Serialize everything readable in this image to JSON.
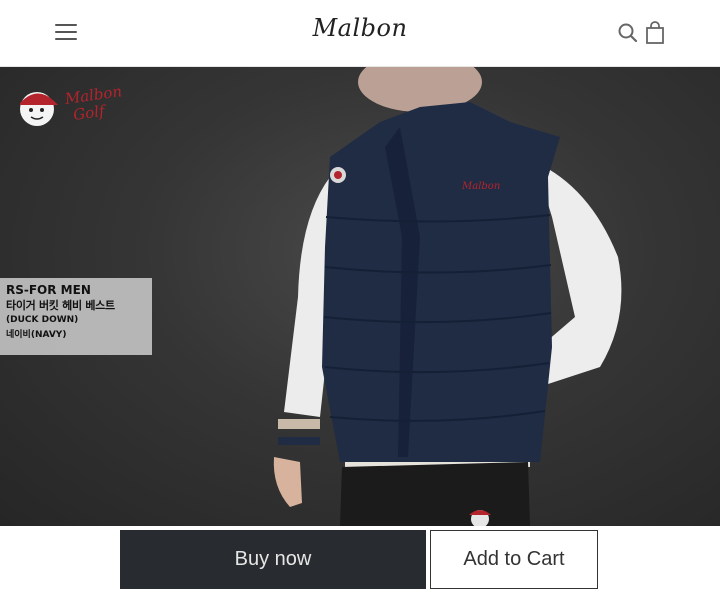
{
  "header": {
    "logo": "Malbon",
    "menu_icon": "hamburger-menu-icon",
    "search_icon": "search-icon",
    "bag_icon": "shopping-bag-icon"
  },
  "hero": {
    "brand_badge": {
      "line1": "Malbon",
      "line2": "Golf",
      "color": "#b3242c",
      "icon": "golf-ball-mascot-icon"
    },
    "vest_logo": "Malbon",
    "product": {
      "line1": "RS-FOR MEN",
      "line2": "타이거 버킷 헤비 베스트",
      "line3": "(DUCK DOWN)",
      "line4": "네이비(NAVY)"
    }
  },
  "actions": {
    "buy_label": "Buy now",
    "cart_label": "Add to Cart"
  },
  "colors": {
    "buy_button": "#282b2f",
    "vest_navy": "#1f2c44",
    "accent_red": "#b3242c"
  }
}
